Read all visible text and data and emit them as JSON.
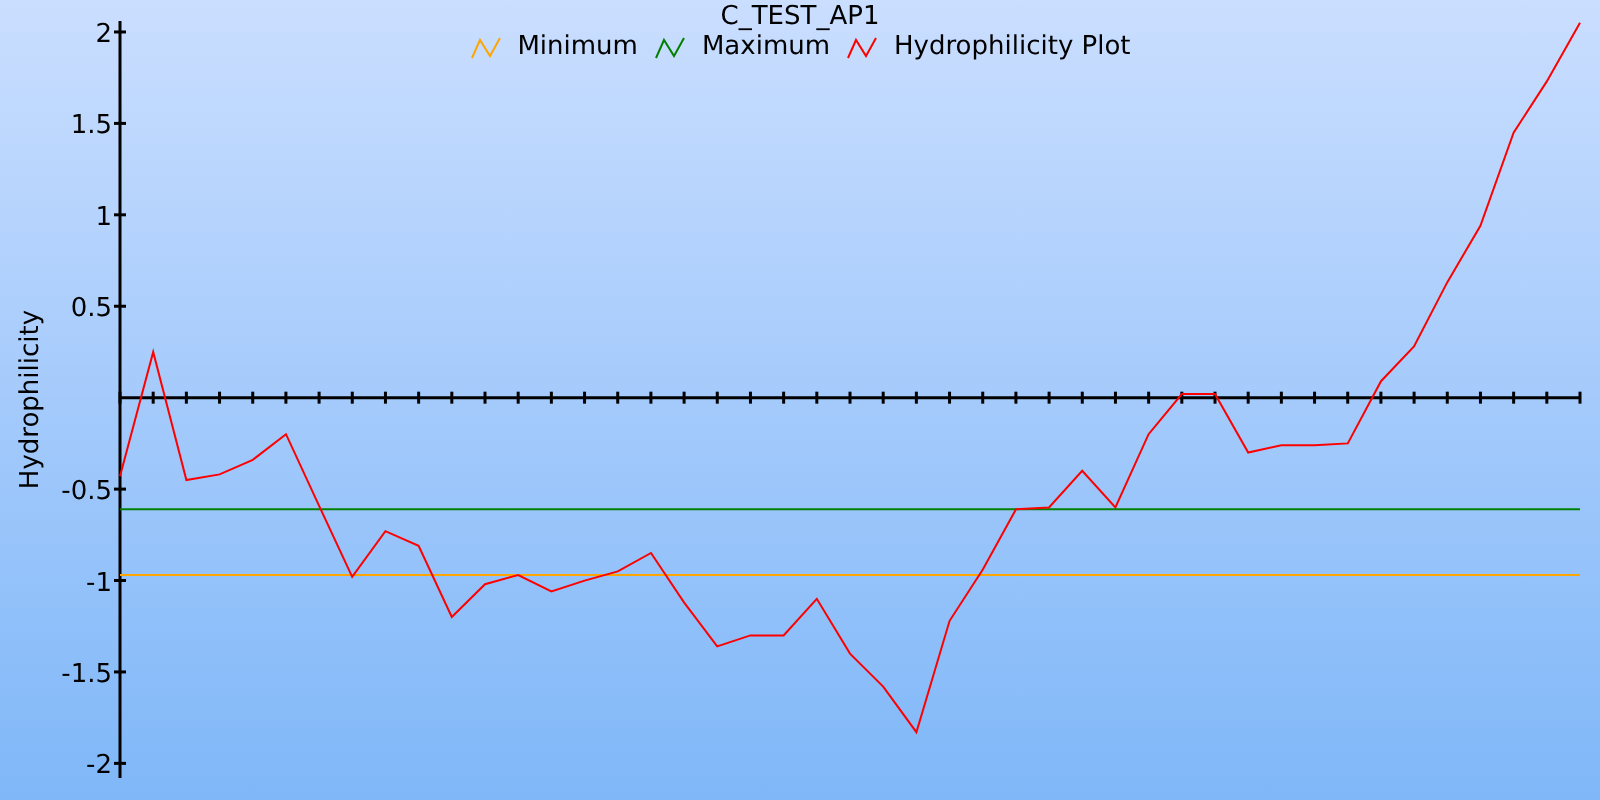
{
  "chart_data": {
    "type": "line",
    "title": "C_TEST_AP1",
    "ylabel": "Hydrophilicity",
    "categories": [
      null,
      null,
      null,
      null,
      null,
      null,
      null,
      null,
      null,
      null,
      null,
      null,
      null,
      null,
      null,
      null,
      null,
      null,
      null,
      null,
      null,
      null,
      null,
      null,
      null,
      null,
      null,
      null,
      null,
      null,
      null,
      null,
      null,
      null,
      null,
      null,
      null,
      null,
      null,
      null,
      null,
      null,
      null,
      null,
      null
    ],
    "series": [
      {
        "name": "Minimum",
        "color": "#ffa500",
        "values": [
          -0.97,
          -0.97,
          -0.97,
          -0.97,
          -0.97,
          -0.97,
          -0.97,
          -0.97,
          -0.97,
          -0.97,
          -0.97,
          -0.97,
          -0.97,
          -0.97,
          -0.97,
          -0.97,
          -0.97,
          -0.97,
          -0.97,
          -0.97,
          -0.97,
          -0.97,
          -0.97,
          -0.97,
          -0.97,
          -0.97,
          -0.97,
          -0.97,
          -0.97,
          -0.97,
          -0.97,
          -0.97,
          -0.97,
          -0.97,
          -0.97,
          -0.97,
          -0.97,
          -0.97,
          -0.97,
          -0.97,
          -0.97,
          -0.97,
          -0.97,
          -0.97,
          -0.97
        ]
      },
      {
        "name": "Maximum",
        "color": "#008000",
        "values": [
          -0.61,
          -0.61,
          -0.61,
          -0.61,
          -0.61,
          -0.61,
          -0.61,
          -0.61,
          -0.61,
          -0.61,
          -0.61,
          -0.61,
          -0.61,
          -0.61,
          -0.61,
          -0.61,
          -0.61,
          -0.61,
          -0.61,
          -0.61,
          -0.61,
          -0.61,
          -0.61,
          -0.61,
          -0.61,
          -0.61,
          -0.61,
          -0.61,
          -0.61,
          -0.61,
          -0.61,
          -0.61,
          -0.61,
          -0.61,
          -0.61,
          -0.61,
          -0.61,
          -0.61,
          -0.61,
          -0.61,
          -0.61,
          -0.61,
          -0.61,
          -0.61,
          -0.61
        ]
      },
      {
        "name": "Hydrophilicity Plot",
        "color": "#ff0000",
        "values": [
          -0.43,
          0.25,
          -0.45,
          -0.42,
          -0.34,
          -0.2,
          -0.59,
          -0.98,
          -0.73,
          -0.81,
          -1.2,
          -1.02,
          -0.97,
          -1.06,
          -1.0,
          -0.95,
          -0.85,
          -1.12,
          -1.36,
          -1.3,
          -1.3,
          -1.1,
          -1.4,
          -1.58,
          -1.83,
          -1.22,
          -0.94,
          -0.61,
          -0.6,
          -0.4,
          -0.6,
          -0.2,
          0.02,
          0.02,
          -0.3,
          -0.26,
          -0.26,
          -0.25,
          0.09,
          0.28,
          0.63,
          0.94,
          1.45,
          1.73,
          2.05
        ]
      }
    ],
    "legend": "top",
    "ylim": [
      -2.08,
      2.06
    ],
    "yticks": [
      -2,
      -1.5,
      -1,
      -0.5,
      0.5,
      1,
      1.5,
      2
    ]
  }
}
